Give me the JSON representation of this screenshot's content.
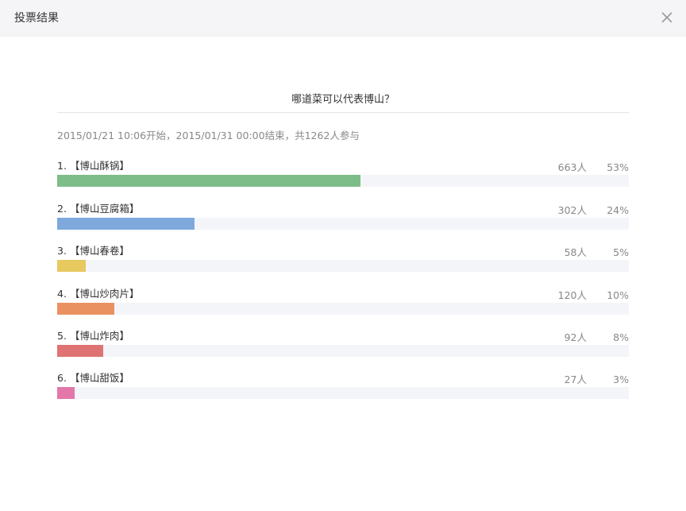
{
  "dialog": {
    "title": "投票结果",
    "close_icon": "close-icon"
  },
  "poll": {
    "question": "哪道菜可以代表博山？",
    "meta": "2015/01/21 10:06开始，2015/01/31 00:00结束，共1262人参与",
    "options": [
      {
        "label": "1. 【博山酥锅】",
        "count": "663人",
        "percent": "53%",
        "fraction": 0.53,
        "color": "#7dbd89"
      },
      {
        "label": "2. 【博山豆腐箱】",
        "count": "302人",
        "percent": "24%",
        "fraction": 0.24,
        "color": "#7fa9dd"
      },
      {
        "label": "3. 【博山春卷】",
        "count": "58人",
        "percent": "5%",
        "fraction": 0.05,
        "color": "#e6c95f"
      },
      {
        "label": "4. 【博山炒肉片】",
        "count": "120人",
        "percent": "10%",
        "fraction": 0.1,
        "color": "#ea9162"
      },
      {
        "label": "5. 【博山炸肉】",
        "count": "92人",
        "percent": "8%",
        "fraction": 0.08,
        "color": "#df7374"
      },
      {
        "label": "6. 【博山甜饭】",
        "count": "27人",
        "percent": "3%",
        "fraction": 0.03,
        "color": "#e377aa"
      }
    ]
  }
}
